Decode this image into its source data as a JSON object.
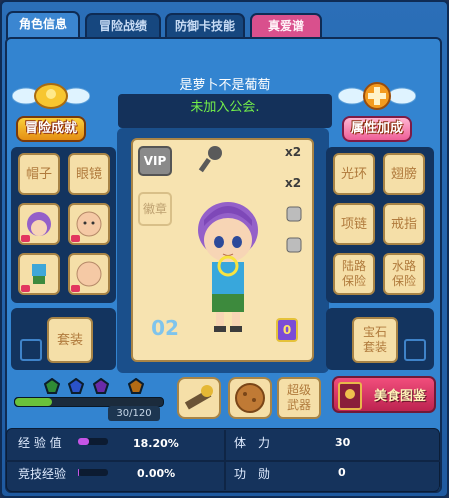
{
  "tabs": [
    {
      "label": "角色信息"
    },
    {
      "label": "冒险战绩"
    },
    {
      "label": "防御卡技能"
    },
    {
      "label": "真爱谱"
    }
  ],
  "player": {
    "name": "是萝卜不是葡萄",
    "guild": "未加入公会."
  },
  "badges": {
    "left": "冒险成就",
    "right": "属性加成"
  },
  "left_slots": [
    {
      "label": "帽子"
    },
    {
      "label": "眼镜"
    },
    {
      "label": "套装"
    }
  ],
  "right_slots": [
    {
      "label": "光环"
    },
    {
      "label": "翅膀"
    },
    {
      "label": "项链"
    },
    {
      "label": "戒指"
    },
    {
      "label": "陆路\n保险"
    },
    {
      "label": "水路\n保险"
    },
    {
      "label": "宝石\n套装"
    }
  ],
  "center": {
    "vip_label": "VIP",
    "emblem_label": "徽章",
    "level_number": "02",
    "rank_number": "0",
    "x2_a": "x2",
    "x2_b": "x2"
  },
  "bottom": {
    "weapon_label": "超级\n武器",
    "food_label": "美食图鉴"
  },
  "level": {
    "text": "30/120",
    "progress": 0.25
  },
  "stats": {
    "exp_label": "经 验 值",
    "exp_value": "18.20%",
    "exp_fraction": 0.182,
    "stamina_label": "体　力",
    "stamina_value": "30",
    "compete_label": "竞技经验",
    "compete_value": "0.00%",
    "compete_fraction": 0.0,
    "merit_label": "功　勋",
    "merit_value": "0"
  }
}
